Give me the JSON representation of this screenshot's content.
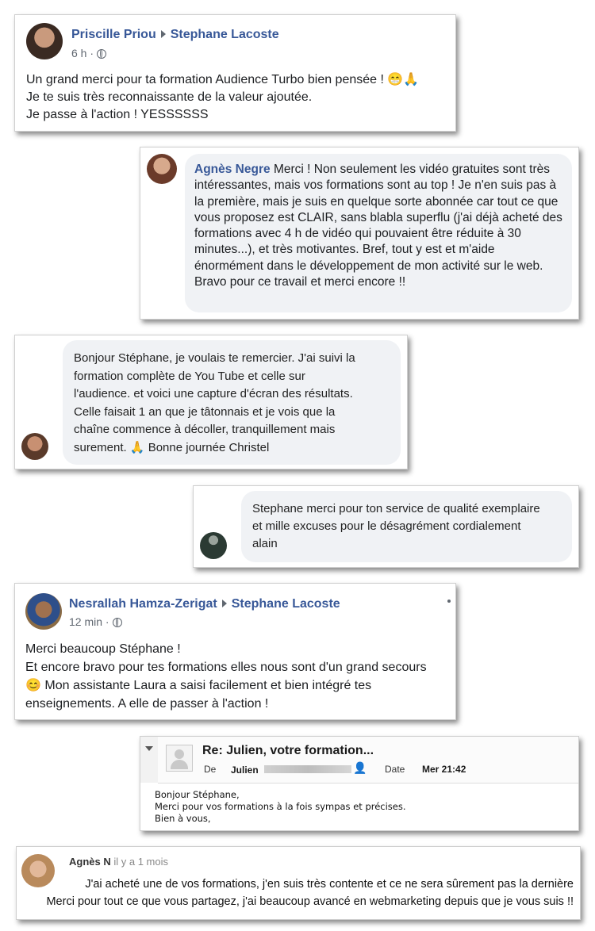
{
  "post1": {
    "author": "Priscille Priou",
    "target": "Stephane Lacoste",
    "time": "6 h ·",
    "lines": [
      "Un grand merci pour ta formation Audience Turbo bien pensée ! 😁🙏",
      "Je te suis très reconnaissante de la valeur ajoutée.",
      "Je passe à l'action ! YESSSSSS"
    ]
  },
  "comment1": {
    "author": "Agnès Negre",
    "text": "Merci ! Non seulement les vidéo gratuites sont très intéressantes, mais vos formations sont au top ! Je n'en suis pas à la première, mais je suis en quelque sorte abonnée car tout ce que vous proposez est CLAIR, sans blabla superflu (j'ai déjà acheté des formations avec 4 h de vidéo qui pouvaient être réduite à 30 minutes...), et très motivantes. Bref, tout y est et m'aide énormément dans le développement de mon activité sur le web. Bravo pour ce travail et merci encore !!"
  },
  "comment2": {
    "lines": [
      "Bonjour Stéphane, je voulais te remercier. J'ai suivi la",
      "formation complète de You Tube et celle sur",
      "l'audience. et voici une capture d'écran des résultats.",
      "Celle faisait 1 an que je tâtonnais et je vois que la",
      "chaîne commence à décoller, tranquillement mais",
      "surement. 🙏  Bonne journée Christel"
    ]
  },
  "comment3": {
    "lines": [
      "Stephane merci pour ton service de qualité exemplaire",
      "et mille excuses pour le désagrément cordialement",
      "alain"
    ]
  },
  "post2": {
    "author": "Nesrallah Hamza-Zerigat",
    "target": "Stephane Lacoste",
    "time": "12 min ·",
    "lines": [
      "Merci beaucoup Stéphane !",
      "Et encore bravo pour tes formations elles nous sont d'un grand secours",
      "😊 Mon assistante Laura a saisi facilement et bien intégré tes",
      "enseignements. A elle de passer à l'action !"
    ]
  },
  "email": {
    "subject": "Re: Julien, votre formation...",
    "de_label": "De",
    "from": "Julien",
    "date_label": "Date",
    "date": "Mer 21:42",
    "body": [
      "Bonjour Stéphane,",
      "Merci pour vos formations à la fois sympas et précises.",
      "Bien à vous,"
    ]
  },
  "review": {
    "author": "Agnès N",
    "time": "il y a 1 mois",
    "lines": [
      "J'ai acheté une de vos formations, j'en suis très contente et ce ne sera sûrement pas la dernière",
      "Merci pour tout ce que vous partagez, j'ai beaucoup avancé en webmarketing depuis que je vous suis !!"
    ]
  }
}
